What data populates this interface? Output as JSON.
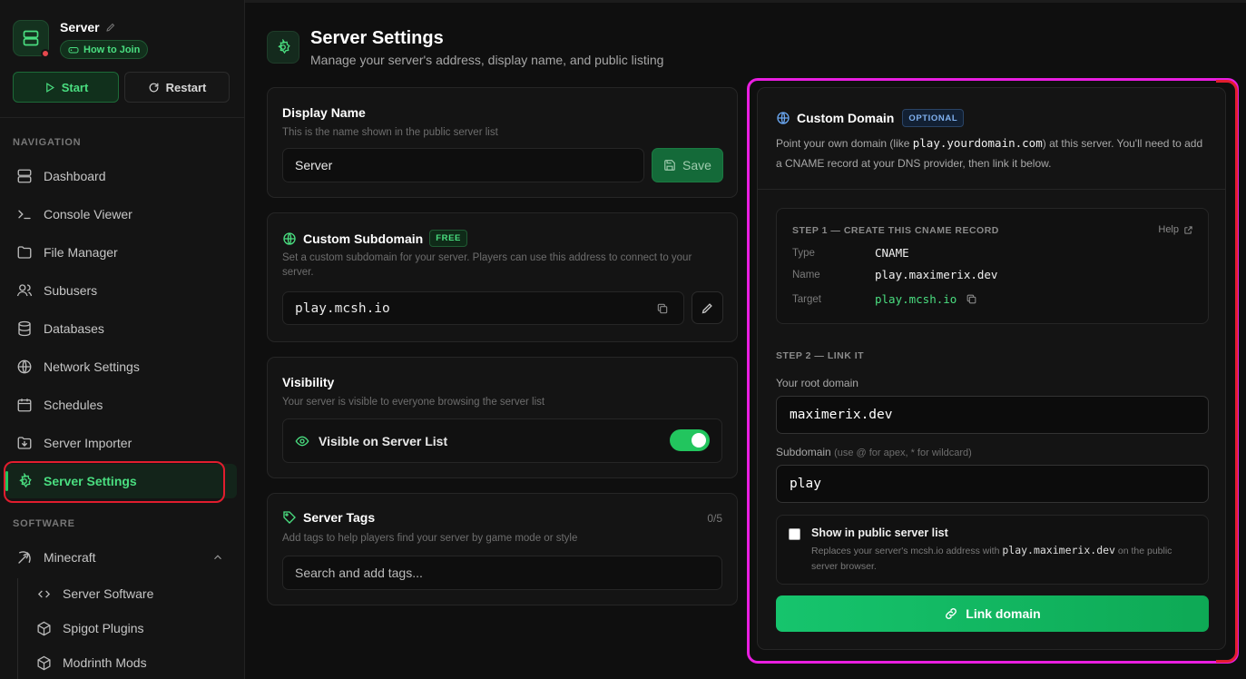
{
  "server": {
    "name": "Server",
    "how_to_join": "How to Join",
    "start_label": "Start",
    "restart_label": "Restart",
    "status_color": "#e5484d"
  },
  "sidebar": {
    "navigation_label": "NAVIGATION",
    "software_label": "SOFTWARE",
    "items": [
      {
        "label": "Dashboard",
        "icon": "server-icon"
      },
      {
        "label": "Console Viewer",
        "icon": "terminal-icon"
      },
      {
        "label": "File Manager",
        "icon": "folder-icon"
      },
      {
        "label": "Subusers",
        "icon": "users-icon"
      },
      {
        "label": "Databases",
        "icon": "database-icon"
      },
      {
        "label": "Network Settings",
        "icon": "globe-icon"
      },
      {
        "label": "Schedules",
        "icon": "calendar-icon"
      },
      {
        "label": "Server Importer",
        "icon": "import-icon"
      },
      {
        "label": "Server Settings",
        "icon": "gear-icon",
        "active": true
      }
    ],
    "software": {
      "group_label": "Minecraft",
      "items": [
        {
          "label": "Server Software",
          "icon": "code-icon"
        },
        {
          "label": "Spigot Plugins",
          "icon": "cube-icon"
        },
        {
          "label": "Modrinth Mods",
          "icon": "cube-icon"
        }
      ]
    }
  },
  "page": {
    "title": "Server Settings",
    "subtitle": "Manage your server's address, display name, and public listing"
  },
  "display_name": {
    "title": "Display Name",
    "description": "This is the name shown in the public server list",
    "value": "Server",
    "save_label": "Save"
  },
  "subdomain": {
    "title": "Custom Subdomain",
    "badge": "FREE",
    "description": "Set a custom subdomain for your server. Players can use this address to connect to your server.",
    "value": "play.mcsh.io"
  },
  "visibility": {
    "title": "Visibility",
    "description": "Your server is visible to everyone browsing the server list",
    "toggle_label": "Visible on Server List",
    "enabled": true
  },
  "tags": {
    "title": "Server Tags",
    "count": "0/5",
    "description": "Add tags to help players find your server by game mode or style",
    "placeholder": "Search and add tags..."
  },
  "custom_domain": {
    "title": "Custom Domain",
    "badge": "OPTIONAL",
    "desc_before": "Point your own domain (like ",
    "desc_code": "play.yourdomain.com",
    "desc_after": ") at this server. You'll need to add a CNAME record at your DNS provider, then link it below.",
    "step1": {
      "label": "STEP 1 — CREATE THIS CNAME RECORD",
      "help": "Help",
      "type_key": "Type",
      "type_val": "CNAME",
      "name_key": "Name",
      "name_val": "play.maximerix.dev",
      "target_key": "Target",
      "target_val": "play.mcsh.io"
    },
    "step2": {
      "label": "STEP 2 — LINK IT",
      "root_label": "Your root domain",
      "root_value": "maximerix.dev",
      "sub_label": "Subdomain",
      "sub_hint": "(use @ for apex, * for wildcard)",
      "sub_value": "play"
    },
    "public": {
      "title": "Show in public server list",
      "desc_before": "Replaces your server's mcsh.io address with ",
      "desc_code": "play.maximerix.dev",
      "desc_after": " on the public server browser.",
      "checked": false
    },
    "link_label": "Link domain"
  },
  "colors": {
    "accent": "#22c55e",
    "highlight_red": "#e11d2e",
    "highlight_magenta": "#e91ee0"
  }
}
